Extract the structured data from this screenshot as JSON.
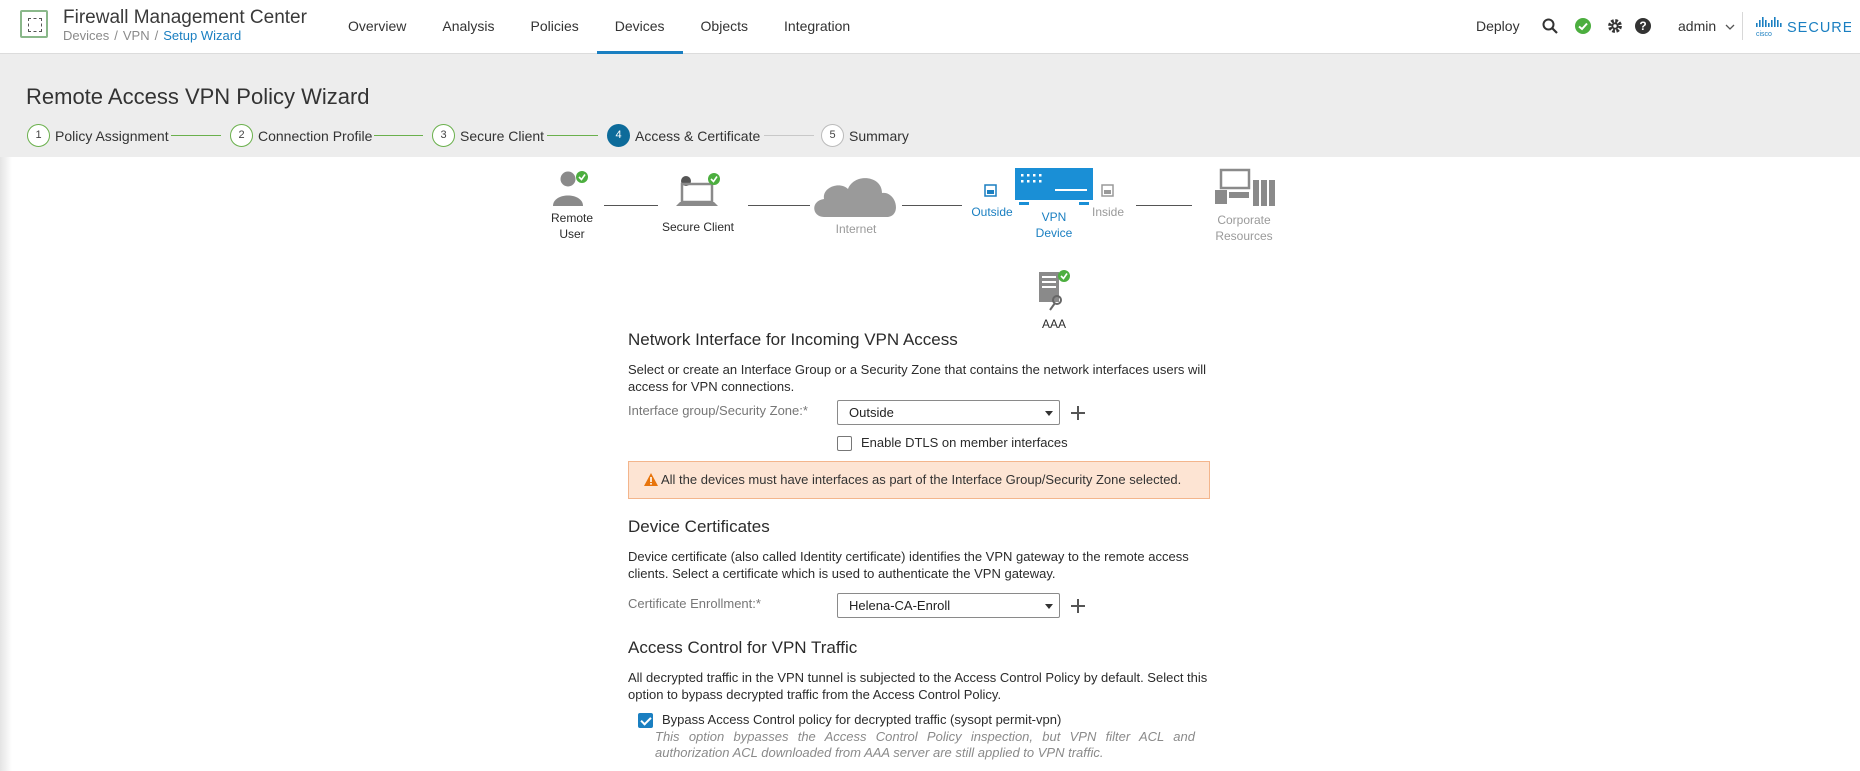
{
  "header": {
    "app_title": "Firewall Management Center",
    "breadcrumb": [
      "Devices",
      "VPN",
      "Setup Wizard"
    ],
    "nav": [
      "Overview",
      "Analysis",
      "Policies",
      "Devices",
      "Objects",
      "Integration"
    ],
    "active_nav": "Devices",
    "deploy_label": "Deploy",
    "user": "admin",
    "brand_text": "SECURE",
    "brand_sub": "cisco",
    "icons": [
      "search-icon",
      "status-ok-icon",
      "gear-icon",
      "help-icon"
    ],
    "accent_color": "#1a7fc1"
  },
  "wizard": {
    "title": "Remote Access VPN Policy Wizard",
    "steps": [
      {
        "num": "1",
        "label": "Policy Assignment",
        "state": "done"
      },
      {
        "num": "2",
        "label": "Connection Profile",
        "state": "done"
      },
      {
        "num": "3",
        "label": "Secure Client",
        "state": "done"
      },
      {
        "num": "4",
        "label": "Access & Certificate",
        "state": "active"
      },
      {
        "num": "5",
        "label": "Summary",
        "state": "todo"
      }
    ]
  },
  "diagram": {
    "remote_user": "Remote User",
    "secure_client": "Secure Client",
    "internet": "Internet",
    "outside": "Outside",
    "vpn_device": "VPN Device",
    "inside": "Inside",
    "corporate": "Corporate Resources",
    "aaa": "AAA"
  },
  "network_interface": {
    "title": "Network Interface for Incoming VPN Access",
    "description": "Select or create an Interface Group or a Security Zone that contains the network interfaces users will access for VPN connections.",
    "zone_label": "Interface group/Security Zone:*",
    "zone_value": "Outside",
    "dtls_label": "Enable DTLS on member interfaces",
    "dtls_checked": false,
    "warning": "All the devices must have interfaces as part of the Interface Group/Security Zone selected."
  },
  "device_certificates": {
    "title": "Device Certificates",
    "description": "Device certificate (also called Identity certificate) identifies the VPN gateway to the remote access clients. Select a certificate which is used to authenticate the VPN gateway.",
    "enroll_label": "Certificate Enrollment:*",
    "enroll_value": "Helena-CA-Enroll"
  },
  "access_control": {
    "title": "Access Control for VPN Traffic",
    "description": "All decrypted traffic in the VPN tunnel is subjected to the Access Control Policy by default. Select this option to bypass decrypted traffic from the Access Control Policy.",
    "bypass_label": "Bypass Access Control policy for decrypted traffic (sysopt permit-vpn)",
    "bypass_checked": true,
    "note": "This option bypasses the Access Control Policy inspection, but VPN filter ACL and authorization ACL downloaded from AAA server are still applied to VPN traffic."
  }
}
